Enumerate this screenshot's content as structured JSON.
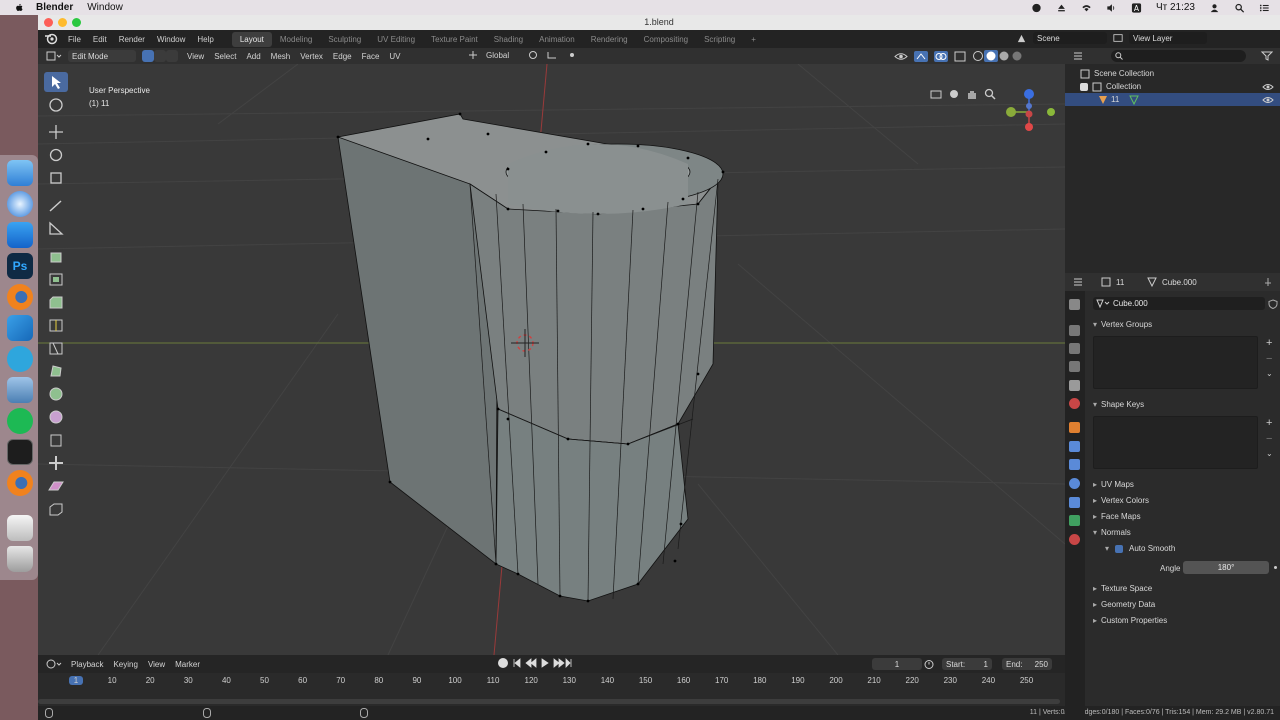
{
  "macos": {
    "app_name": "Blender",
    "menu_window": "Window",
    "clock": "Чт 21:23"
  },
  "window": {
    "title": "1.blend"
  },
  "topbar": {
    "menus": [
      "File",
      "Edit",
      "Render",
      "Window",
      "Help"
    ],
    "workspaces": [
      "Layout",
      "Modeling",
      "Sculpting",
      "UV Editing",
      "Texture Paint",
      "Shading",
      "Animation",
      "Rendering",
      "Compositing",
      "Scripting"
    ],
    "active_workspace": "Layout",
    "add_tab": "+",
    "scene_label": "Scene",
    "view_layer_label": "View Layer"
  },
  "viewport_header": {
    "mode": "Edit Mode",
    "menus": [
      "View",
      "Select",
      "Add",
      "Mesh",
      "Vertex",
      "Edge",
      "Face",
      "UV"
    ],
    "orientation": "Global"
  },
  "viewport": {
    "perspective": "User Perspective",
    "object_info": "(1) 11"
  },
  "timeline": {
    "menus": [
      "Playback",
      "Keying",
      "View",
      "Marker"
    ],
    "current_frame": "1",
    "start_label": "Start:",
    "start_value": "1",
    "end_label": "End:",
    "end_value": "250",
    "ruler_ticks": [
      "1",
      "10",
      "20",
      "30",
      "40",
      "50",
      "60",
      "70",
      "80",
      "90",
      "100",
      "110",
      "120",
      "130",
      "140",
      "150",
      "160",
      "170",
      "180",
      "190",
      "200",
      "210",
      "220",
      "230",
      "240",
      "250"
    ]
  },
  "status": {
    "text": "11 | Verts:0/89 | Edges:0/180 | Faces:0/76 | Tris:154 | Mem: 29.2 MB | v2.80.71"
  },
  "outliner": {
    "scene_collection": "Scene Collection",
    "collection": "Collection",
    "object": "11"
  },
  "properties": {
    "object_name": "11",
    "mesh_name": "Cube.000",
    "mesh_field": "Cube.000",
    "sections": {
      "vertex_groups": "Vertex Groups",
      "shape_keys": "Shape Keys",
      "uv_maps": "UV Maps",
      "vertex_colors": "Vertex Colors",
      "face_maps": "Face Maps",
      "normals": "Normals",
      "auto_smooth": "Auto Smooth",
      "angle_label": "Angle",
      "angle_value": "180°",
      "texture_space": "Texture Space",
      "geometry_data": "Geometry Data",
      "custom_properties": "Custom Properties"
    }
  },
  "colors": {
    "accent": "#4772b3",
    "selection": "#334d80",
    "viewport_bg": "#393939",
    "axis_x": "#c84646",
    "axis_y": "#8aab3a"
  }
}
